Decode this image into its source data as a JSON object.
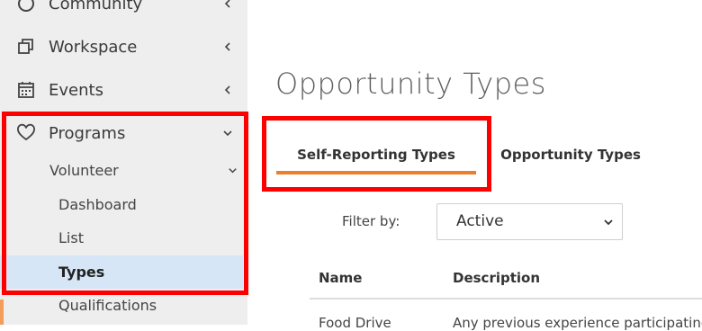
{
  "sidebar": {
    "items": [
      {
        "label": "Community",
        "icon": "circle-icon"
      },
      {
        "label": "Workspace",
        "icon": "copy-icon"
      },
      {
        "label": "Events",
        "icon": "calendar-icon"
      },
      {
        "label": "Programs",
        "icon": "heart-icon"
      }
    ],
    "sub_group": {
      "label": "Volunteer"
    },
    "sub_items": [
      {
        "label": "Dashboard"
      },
      {
        "label": "List"
      },
      {
        "label": "Types",
        "active": true
      },
      {
        "label": "Qualifications"
      }
    ]
  },
  "main": {
    "title": "Opportunity Types",
    "tabs": [
      {
        "label": "Self-Reporting Types",
        "active": true
      },
      {
        "label": "Opportunity Types",
        "active": false
      }
    ],
    "filter": {
      "label": "Filter by:",
      "value": "Active"
    },
    "table": {
      "columns": [
        "Name",
        "Description"
      ],
      "rows": [
        [
          "Food Drive",
          "Any previous experience participating"
        ]
      ]
    }
  },
  "colors": {
    "highlight": "#ff0000",
    "tab_underline": "#ef7d2b",
    "active_sub_bg": "#d6e6f7"
  }
}
